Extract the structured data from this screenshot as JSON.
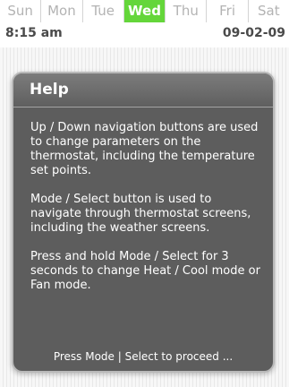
{
  "days": [
    "Sun",
    "Mon",
    "Tue",
    "Wed",
    "Thu",
    "Fri",
    "Sat"
  ],
  "active_day": "Wed",
  "status": {
    "time": "8:15 am",
    "date": "09-02-09"
  },
  "help": {
    "title": "Help",
    "paragraphs": [
      "Up / Down navigation buttons are used to change parameters on the thermostat, including the temperature set points.",
      "Mode / Select button is used to navigate through thermostat screens, including the weather screens.",
      "Press and hold Mode / Select for 3 seconds to change Heat / Cool mode or Fan mode."
    ],
    "footer": "Press Mode | Select to proceed ..."
  },
  "colors": {
    "active_day": "#64d63a",
    "inactive_day_text": "#b3b3b3",
    "card_background": "#5d5d5d"
  }
}
